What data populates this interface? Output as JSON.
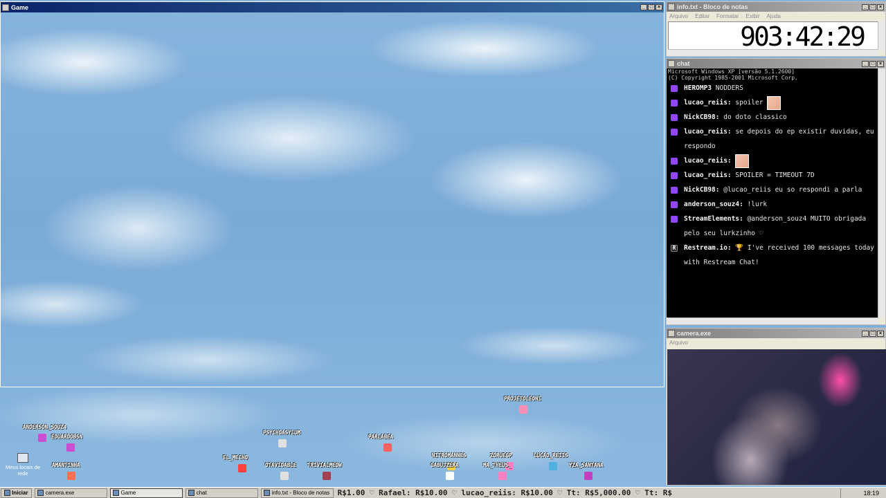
{
  "game_window": {
    "title": "Game"
  },
  "notepad": {
    "title": "info.txt - Bloco de notas",
    "menu": [
      "Arquivo",
      "Editar",
      "Formatar",
      "Exibir",
      "Ajuda"
    ],
    "timer": "903:42:29"
  },
  "chat": {
    "title": "chat",
    "cmd_header": [
      "Microsoft Windows XP [versão 5.1.2600]",
      "(C) Copyright 1985-2001 Microsoft Corp."
    ],
    "messages": [
      {
        "user": "HEROMP3",
        "text": "NODDERS",
        "icon": "twitch-icon"
      },
      {
        "user": "lucao_reiis:",
        "text": "spoiler",
        "icon": "twitch-icon",
        "emote": true
      },
      {
        "user": "NickCB98:",
        "text": "do doto classico",
        "icon": "twitch-icon"
      },
      {
        "user": "lucao_reiis:",
        "text": "se depois do ep existir duvidas, eu respondo",
        "icon": "twitch-icon"
      },
      {
        "user": "lucao_reiis:",
        "text": "",
        "icon": "twitch-icon",
        "emote": true
      },
      {
        "user": "lucao_reiis:",
        "text": "SPOILER = TIMEOUT 7D",
        "icon": "twitch-icon"
      },
      {
        "user": "NickCB98:",
        "text": "@lucao_reiis eu so respondi a parla",
        "icon": "twitch-icon"
      },
      {
        "user": "anderson_souz4:",
        "text": "!lurk",
        "icon": "twitch-icon"
      },
      {
        "user": "StreamElements:",
        "text": "@anderson_souz4 MUITO obrigada pelo seu lurkzinho ♡",
        "icon": "twitch-icon"
      },
      {
        "user": "Restream.io:",
        "text": "🏆 I've received 100 messages today with Restream Chat!",
        "icon": "restream-icon"
      }
    ]
  },
  "camera": {
    "title": "camera.exe",
    "menu": [
      "Arquivo"
    ]
  },
  "viewers": [
    {
      "name": "PROJETOLEONI"
    },
    {
      "name": "ANDERSON_SOUZ4"
    },
    {
      "name": "EDUARDOBSN"
    },
    {
      "name": "PSYCHOASYLUM"
    },
    {
      "name": "PARLABEA"
    },
    {
      "name": "EL_MECHO"
    },
    {
      "name": "AMANTINHA"
    },
    {
      "name": "OTAVIOABLE"
    },
    {
      "name": "TRIVIALMEOW"
    },
    {
      "name": "NITROMANNES"
    },
    {
      "name": "ZORUEGP"
    },
    {
      "name": "LUCAO_REIIS"
    },
    {
      "name": "GABUJZERA"
    },
    {
      "name": "MA_THEUS_"
    },
    {
      "name": "YZA_SANTANA"
    }
  ],
  "desktop_icon": {
    "label": "Meus locais de rede"
  },
  "taskbar": {
    "start_label": "Iniciar",
    "tasks": [
      {
        "label": "camera.exe",
        "active": false
      },
      {
        "label": "Game",
        "active": true
      },
      {
        "label": "chat",
        "active": false
      },
      {
        "label": "info.txt - Bloco de notas",
        "active": false
      }
    ],
    "ticker": "R$1.00 ♡  Rafael: R$10.00 ♡  lucao_reiis: R$10.00 ♡  Tt: R$5,000.00 ♡  Tt: R$",
    "clock": "18:19"
  },
  "colors": {
    "titlebar_active": "#0a246a",
    "chat_bg": "#000000",
    "twitch_purple": "#9147ff"
  }
}
